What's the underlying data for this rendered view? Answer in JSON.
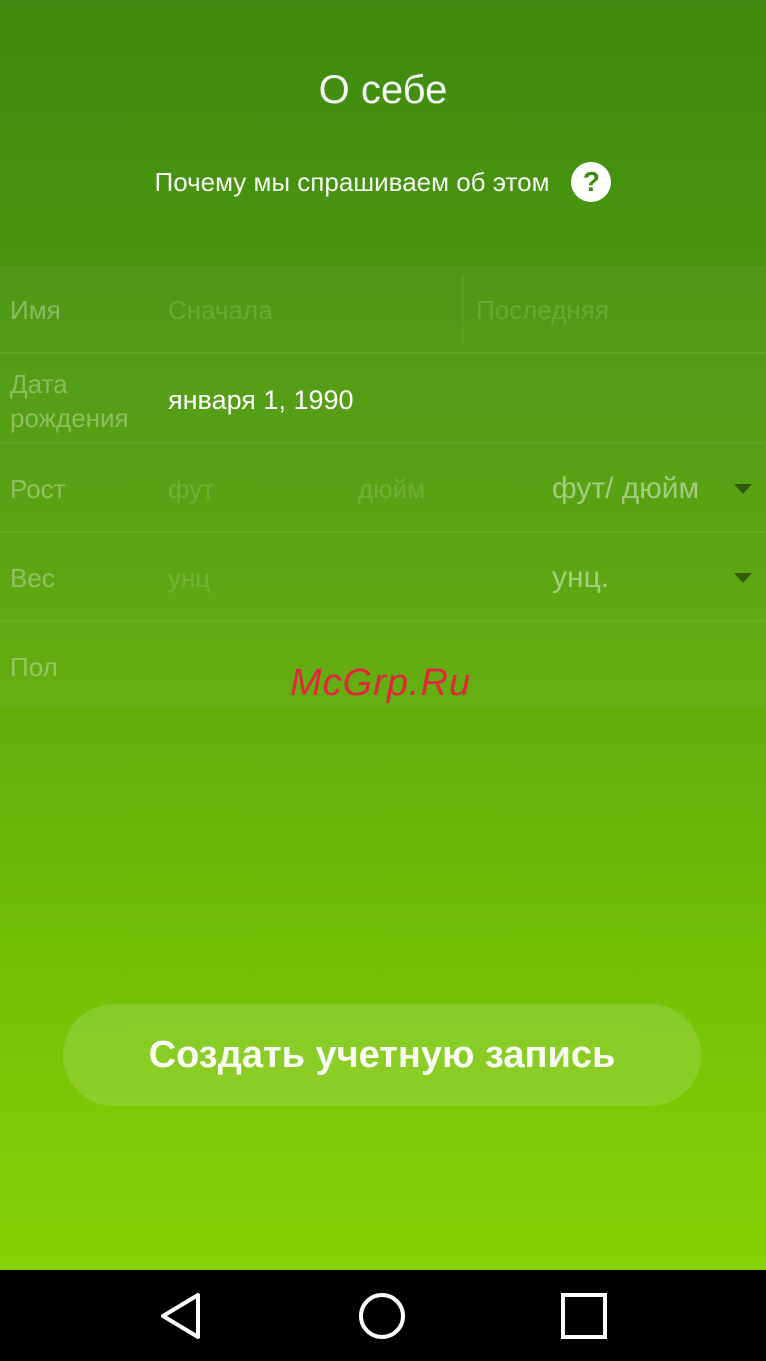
{
  "header": {
    "title": "О себе",
    "why_text": "Почему мы спрашиваем об этом",
    "help_glyph": "?"
  },
  "form": {
    "name": {
      "label": "Имя",
      "first_placeholder": "Сначала",
      "last_placeholder": "Последняя"
    },
    "birthdate": {
      "label_line1": "Дата",
      "label_line2": "рождения",
      "value": "января 1, 1990"
    },
    "height": {
      "label": "Рост",
      "feet_placeholder": "фут",
      "inches_placeholder": "дюйм",
      "unit": "фут/ дюйм"
    },
    "weight": {
      "label": "Вес",
      "placeholder": "унц",
      "unit": "унц."
    },
    "gender": {
      "label": "Пол"
    }
  },
  "watermark": "McGrp.Ru",
  "actions": {
    "create_label": "Создать учетную запись"
  },
  "navbar": {
    "back_icon": "back-triangle-icon",
    "home_icon": "home-circle-icon",
    "recents_icon": "recents-square-icon"
  },
  "colors": {
    "gradient_top": "#3f8a10",
    "gradient_bottom": "#86d104",
    "watermark": "#e5263a",
    "navbar": "#000000"
  }
}
